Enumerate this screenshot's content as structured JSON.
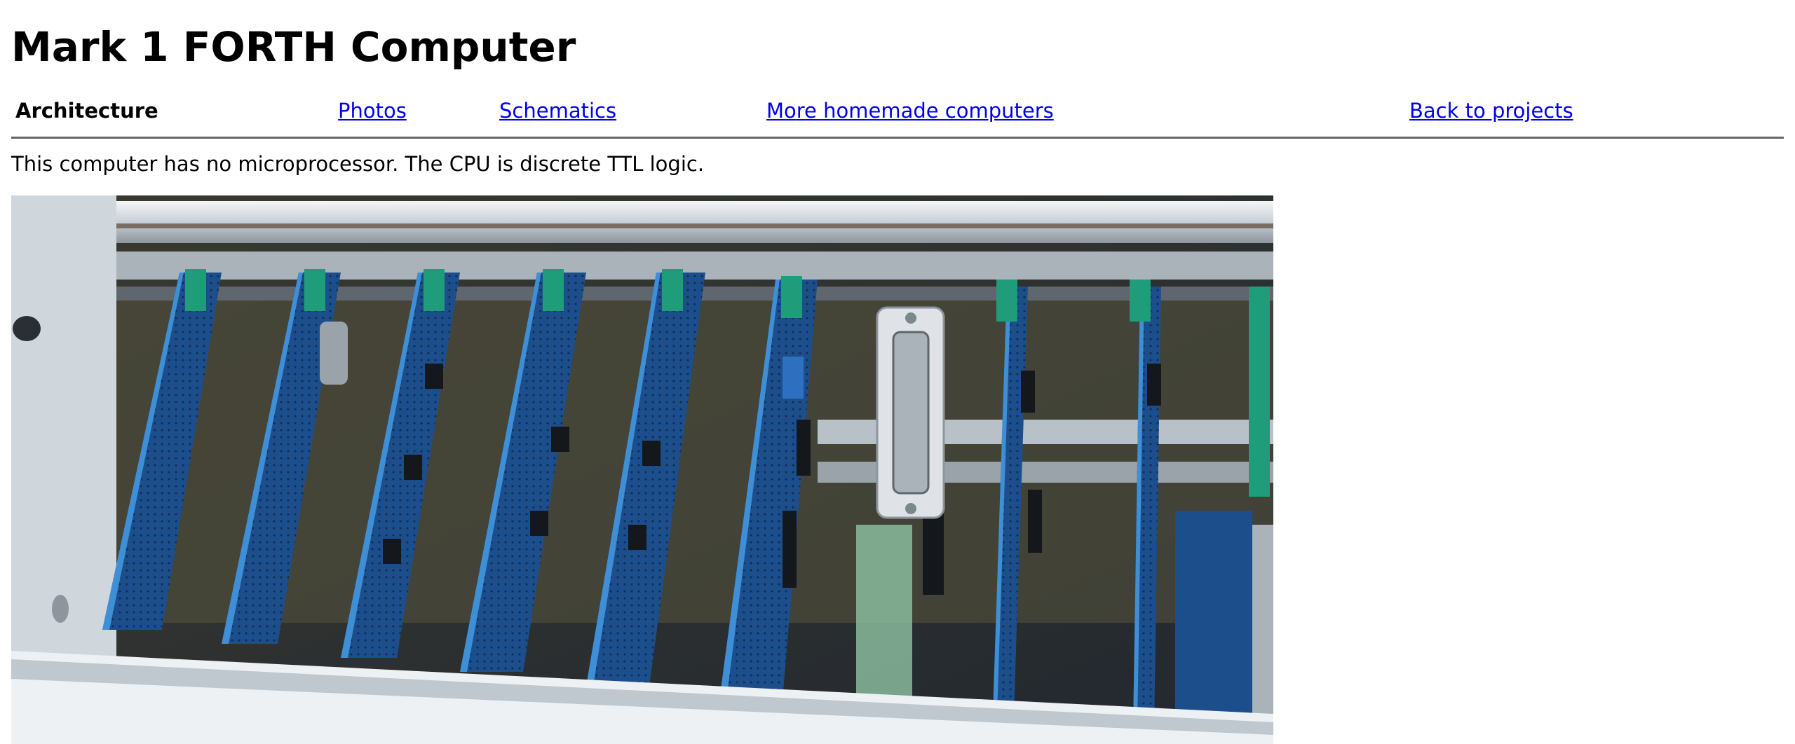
{
  "page": {
    "title": "Mark 1 FORTH Computer"
  },
  "nav": {
    "current": "Architecture",
    "links": [
      {
        "label": "Photos"
      },
      {
        "label": "Schematics"
      },
      {
        "label": "More homemade computers"
      },
      {
        "label": "Back to projects"
      }
    ]
  },
  "content": {
    "intro": "This computer has no microprocessor. The CPU is discrete TTL logic."
  },
  "colors": {
    "link": "#0000ee",
    "divider": "#666666",
    "board_blue": "#1d4e8c",
    "rail_green": "#1f9c7a"
  }
}
